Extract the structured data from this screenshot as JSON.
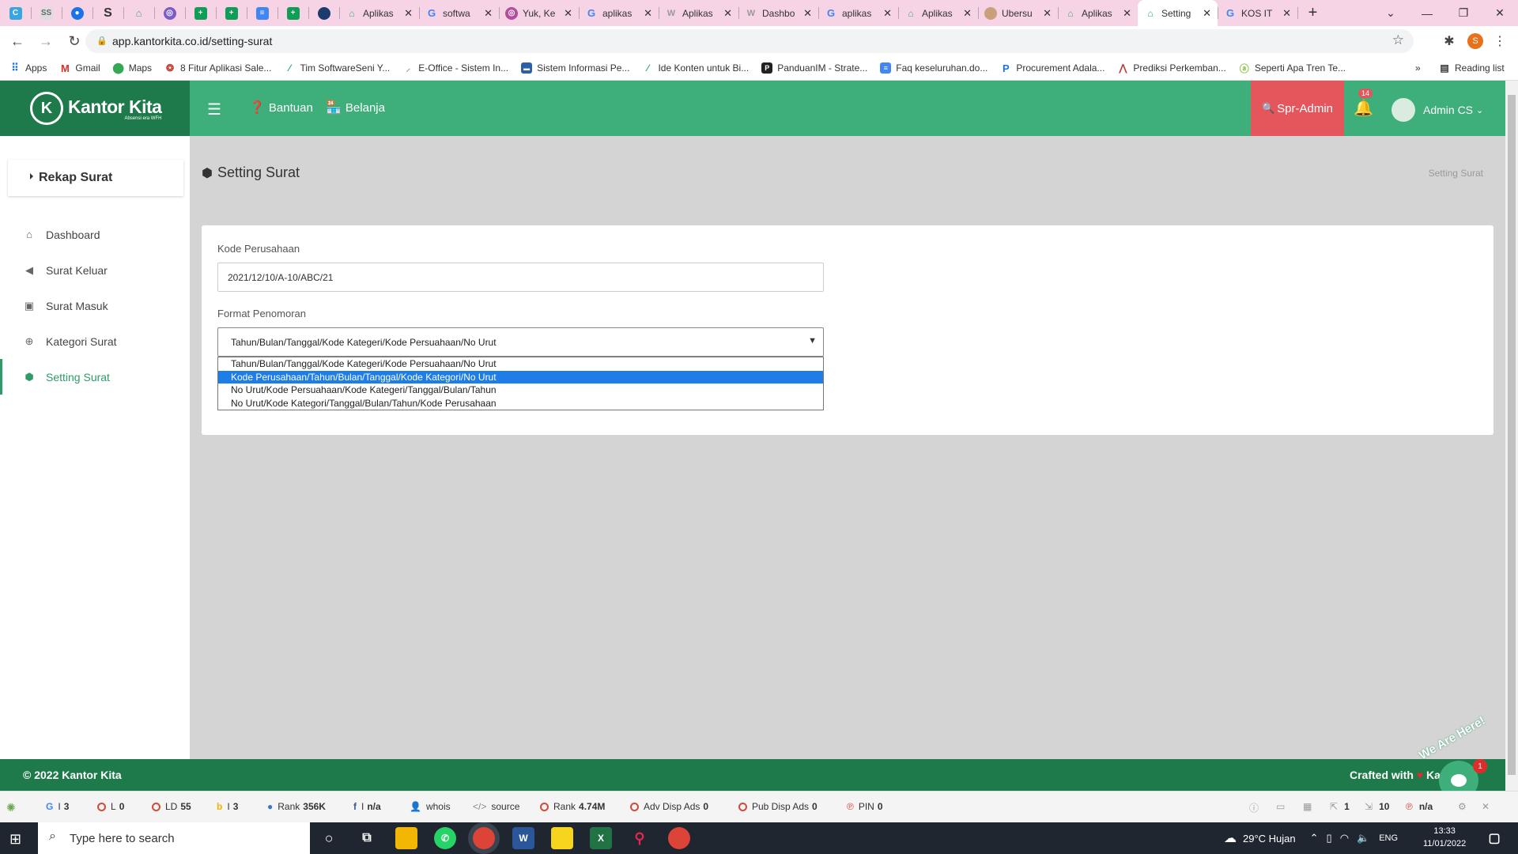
{
  "browser": {
    "tabs": [
      {
        "title": "Aplikas",
        "icon": "site-icon"
      },
      {
        "title": "softwa",
        "icon": "google-icon"
      },
      {
        "title": "Yuk, Ke",
        "icon": "site-icon"
      },
      {
        "title": "aplikas",
        "icon": "google-icon"
      },
      {
        "title": "Aplikas",
        "icon": "site-icon"
      },
      {
        "title": "Dashbo",
        "icon": "site-icon"
      },
      {
        "title": "aplikas",
        "icon": "google-icon"
      },
      {
        "title": "Aplikas",
        "icon": "site-icon"
      },
      {
        "title": "Ubersu",
        "icon": "site-icon"
      },
      {
        "title": "Aplikas",
        "icon": "site-icon"
      },
      {
        "title": "Setting",
        "icon": "site-icon"
      },
      {
        "title": "KOS IT",
        "icon": "google-icon"
      }
    ],
    "url": "app.kantorkita.co.id/setting-surat",
    "bookmarks": [
      "Apps",
      "Gmail",
      "Maps",
      "8 Fitur Aplikasi Sale...",
      "Tim SoftwareSeni Y...",
      "E-Office - Sistem In...",
      "Sistem Informasi Pe...",
      "Ide Konten untuk Bi...",
      "PanduanIM - Strate...",
      "Faq keseluruhan.do...",
      "Procurement Adala...",
      "Prediksi Perkemban...",
      "Seperti Apa Tren Te..."
    ],
    "reading_list": "Reading list",
    "profile_initial": "S"
  },
  "app": {
    "logo_title": "Kantor Kita",
    "logo_subtitle": "Absensi era WFH",
    "nav_help": "Bantuan",
    "nav_shop": "Belanja",
    "role": "Spr-Admin",
    "notif_count": "14",
    "user": "Admin CS"
  },
  "sidebar": {
    "header": "Rekap Surat",
    "items": [
      "Dashboard",
      "Surat Keluar",
      "Surat Masuk",
      "Kategori Surat",
      "Setting Surat"
    ]
  },
  "page": {
    "title": "Setting Surat",
    "breadcrumb": "Setting Surat",
    "kode_label": "Kode Perusahaan",
    "kode_value": "2021/12/10/A-10/ABC/21",
    "format_label": "Format Penomoran",
    "format_selected": "Tahun/Bulan/Tanggal/Kode Kategeri/Kode Persuahaan/No Urut",
    "format_options": [
      "Tahun/Bulan/Tanggal/Kode Kategeri/Kode Persuahaan/No Urut",
      "Kode Perusahaan/Tahun/Bulan/Tanggal/Kode Kategori/No Urut",
      "No Urut/Kode Persuahaan/Kode Kategeri/Tanggal/Bulan/Tahun",
      "No Urut/Kode Kategori/Tanggal/Bulan/Tahun/Kode Perusahaan"
    ]
  },
  "footer": {
    "copyright": "© 2022 Kantor Kita",
    "crafted": "Crafted with",
    "crafted_tail": "Kar",
    "we_are_here": "We Are Here!",
    "chat_badge": "1"
  },
  "seo_toolbar": {
    "g": "3",
    "l": "0",
    "ld_label": "LD",
    "ld": "55",
    "b": "3",
    "rank_label": "Rank",
    "rank": "356K",
    "fb": "n/a",
    "whois": "whois",
    "source": "source",
    "rank2_label": "Rank",
    "rank2": "4.74M",
    "adv_label": "Adv Disp Ads",
    "adv": "0",
    "pub_label": "Pub Disp Ads",
    "pub": "0",
    "pin_label": "PIN",
    "pin": "0",
    "right1": "1",
    "right2": "10",
    "right3": "n/a"
  },
  "taskbar": {
    "search_placeholder": "Type here to search",
    "weather": "29°C  Hujan",
    "lang": "ENG",
    "time": "13:33",
    "date": "11/01/2022"
  }
}
